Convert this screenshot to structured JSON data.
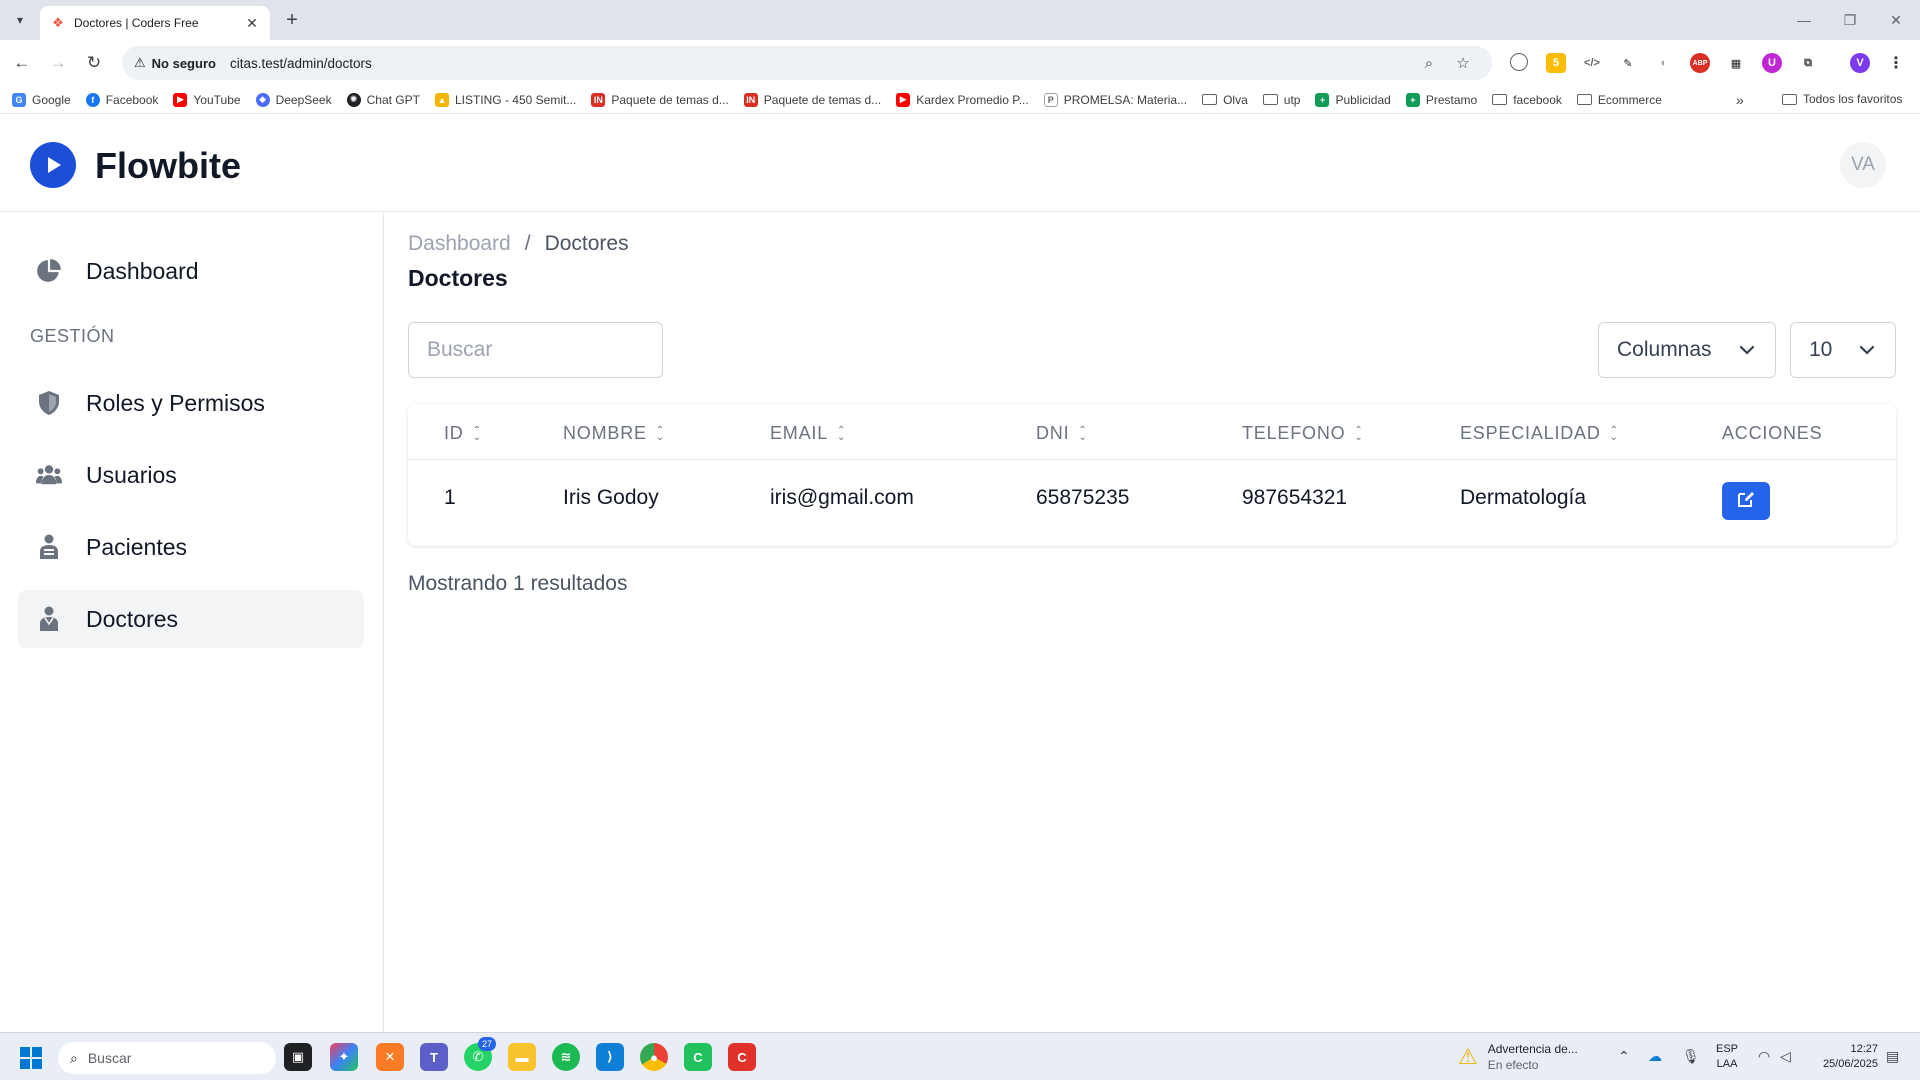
{
  "browser": {
    "tab_title": "Doctores | Coders Free",
    "security_label": "No seguro",
    "url": "citas.test/admin/doctors",
    "bookmarks": [
      {
        "label": "Google",
        "icon": "google-icon",
        "color": "#4285f4"
      },
      {
        "label": "Facebook",
        "icon": "facebook-icon",
        "color": "#1877f2"
      },
      {
        "label": "YouTube",
        "icon": "youtube-icon",
        "color": "#ff0000"
      },
      {
        "label": "DeepSeek",
        "icon": "deepseek-icon",
        "color": "#4d6bfe"
      },
      {
        "label": "Chat GPT",
        "icon": "chatgpt-icon",
        "color": "#202124"
      },
      {
        "label": "LISTING - 450 Semit...",
        "icon": "drive-icon",
        "color": "#f4b400"
      },
      {
        "label": "Paquete de temas d...",
        "icon": "in-icon",
        "color": "#d93025"
      },
      {
        "label": "Paquete de temas d...",
        "icon": "in-icon",
        "color": "#d93025"
      },
      {
        "label": "Kardex Promedio P...",
        "icon": "youtube-icon",
        "color": "#ff0000"
      },
      {
        "label": "PROMELSA: Materia...",
        "icon": "page-icon",
        "color": "#9aa0a6"
      },
      {
        "label": "Olva",
        "icon": "folder-icon"
      },
      {
        "label": "utp",
        "icon": "folder-icon"
      },
      {
        "label": "Publicidad",
        "icon": "sheets-icon",
        "color": "#0f9d58"
      },
      {
        "label": "Prestamo",
        "icon": "sheets-icon",
        "color": "#0f9d58"
      },
      {
        "label": "facebook",
        "icon": "folder-icon"
      },
      {
        "label": "Ecommerce",
        "icon": "folder-icon"
      }
    ],
    "all_bookmarks_label": "Todos los favoritos"
  },
  "app": {
    "brand": "Flowbite",
    "brand_color": "#1d4ed8",
    "avatar_initials": "VA",
    "sidebar": {
      "items": [
        {
          "label": "Dashboard",
          "icon": "pie-chart-icon"
        },
        {
          "label": "Roles y Permisos",
          "icon": "shield-icon"
        },
        {
          "label": "Usuarios",
          "icon": "users-icon"
        },
        {
          "label": "Pacientes",
          "icon": "patient-icon"
        },
        {
          "label": "Doctores",
          "icon": "doctor-icon"
        }
      ],
      "section_label": "GESTIÓN",
      "active": "Doctores"
    },
    "breadcrumb": {
      "root": "Dashboard",
      "separator": "/",
      "current": "Doctores"
    },
    "page_title": "Doctores",
    "search_placeholder": "Buscar",
    "columns_label": "Columnas",
    "per_page": "10",
    "table": {
      "headers": [
        "ID",
        "NOMBRE",
        "EMAIL",
        "DNI",
        "TELEFONO",
        "ESPECIALIDAD",
        "ACCIONES"
      ],
      "rows": [
        {
          "id": "1",
          "nombre": "Iris Godoy",
          "email": "iris@gmail.com",
          "dni": "65875235",
          "telefono": "987654321",
          "especialidad": "Dermatología"
        }
      ]
    },
    "results_text": "Mostrando 1 resultados",
    "accent_color": "#2563eb"
  },
  "taskbar": {
    "search_label": "Buscar",
    "teams_badge": "27",
    "weather_title": "Advertencia de...",
    "weather_sub": "En efecto",
    "lang_1": "ESP",
    "lang_2": "LAA",
    "time": "12:27",
    "date": "25/06/2025"
  }
}
